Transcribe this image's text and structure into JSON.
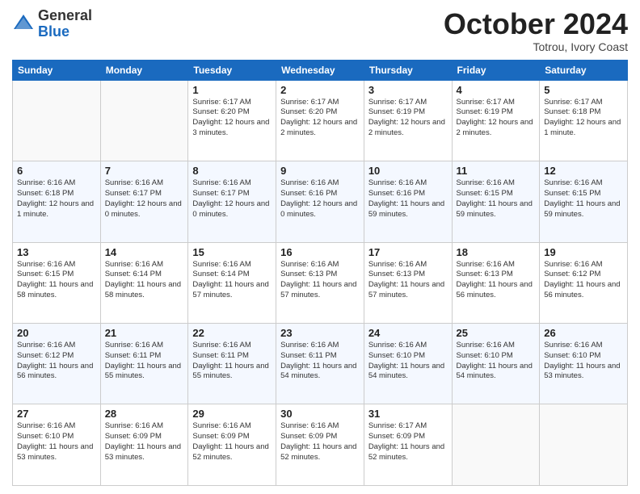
{
  "logo": {
    "general": "General",
    "blue": "Blue"
  },
  "header": {
    "month": "October 2024",
    "location": "Totrou, Ivory Coast"
  },
  "days_of_week": [
    "Sunday",
    "Monday",
    "Tuesday",
    "Wednesday",
    "Thursday",
    "Friday",
    "Saturday"
  ],
  "weeks": [
    [
      {
        "day": "",
        "info": ""
      },
      {
        "day": "",
        "info": ""
      },
      {
        "day": "1",
        "info": "Sunrise: 6:17 AM\nSunset: 6:20 PM\nDaylight: 12 hours and 3 minutes."
      },
      {
        "day": "2",
        "info": "Sunrise: 6:17 AM\nSunset: 6:20 PM\nDaylight: 12 hours and 2 minutes."
      },
      {
        "day": "3",
        "info": "Sunrise: 6:17 AM\nSunset: 6:19 PM\nDaylight: 12 hours and 2 minutes."
      },
      {
        "day": "4",
        "info": "Sunrise: 6:17 AM\nSunset: 6:19 PM\nDaylight: 12 hours and 2 minutes."
      },
      {
        "day": "5",
        "info": "Sunrise: 6:17 AM\nSunset: 6:18 PM\nDaylight: 12 hours and 1 minute."
      }
    ],
    [
      {
        "day": "6",
        "info": "Sunrise: 6:16 AM\nSunset: 6:18 PM\nDaylight: 12 hours and 1 minute."
      },
      {
        "day": "7",
        "info": "Sunrise: 6:16 AM\nSunset: 6:17 PM\nDaylight: 12 hours and 0 minutes."
      },
      {
        "day": "8",
        "info": "Sunrise: 6:16 AM\nSunset: 6:17 PM\nDaylight: 12 hours and 0 minutes."
      },
      {
        "day": "9",
        "info": "Sunrise: 6:16 AM\nSunset: 6:16 PM\nDaylight: 12 hours and 0 minutes."
      },
      {
        "day": "10",
        "info": "Sunrise: 6:16 AM\nSunset: 6:16 PM\nDaylight: 11 hours and 59 minutes."
      },
      {
        "day": "11",
        "info": "Sunrise: 6:16 AM\nSunset: 6:15 PM\nDaylight: 11 hours and 59 minutes."
      },
      {
        "day": "12",
        "info": "Sunrise: 6:16 AM\nSunset: 6:15 PM\nDaylight: 11 hours and 59 minutes."
      }
    ],
    [
      {
        "day": "13",
        "info": "Sunrise: 6:16 AM\nSunset: 6:15 PM\nDaylight: 11 hours and 58 minutes."
      },
      {
        "day": "14",
        "info": "Sunrise: 6:16 AM\nSunset: 6:14 PM\nDaylight: 11 hours and 58 minutes."
      },
      {
        "day": "15",
        "info": "Sunrise: 6:16 AM\nSunset: 6:14 PM\nDaylight: 11 hours and 57 minutes."
      },
      {
        "day": "16",
        "info": "Sunrise: 6:16 AM\nSunset: 6:13 PM\nDaylight: 11 hours and 57 minutes."
      },
      {
        "day": "17",
        "info": "Sunrise: 6:16 AM\nSunset: 6:13 PM\nDaylight: 11 hours and 57 minutes."
      },
      {
        "day": "18",
        "info": "Sunrise: 6:16 AM\nSunset: 6:13 PM\nDaylight: 11 hours and 56 minutes."
      },
      {
        "day": "19",
        "info": "Sunrise: 6:16 AM\nSunset: 6:12 PM\nDaylight: 11 hours and 56 minutes."
      }
    ],
    [
      {
        "day": "20",
        "info": "Sunrise: 6:16 AM\nSunset: 6:12 PM\nDaylight: 11 hours and 56 minutes."
      },
      {
        "day": "21",
        "info": "Sunrise: 6:16 AM\nSunset: 6:11 PM\nDaylight: 11 hours and 55 minutes."
      },
      {
        "day": "22",
        "info": "Sunrise: 6:16 AM\nSunset: 6:11 PM\nDaylight: 11 hours and 55 minutes."
      },
      {
        "day": "23",
        "info": "Sunrise: 6:16 AM\nSunset: 6:11 PM\nDaylight: 11 hours and 54 minutes."
      },
      {
        "day": "24",
        "info": "Sunrise: 6:16 AM\nSunset: 6:10 PM\nDaylight: 11 hours and 54 minutes."
      },
      {
        "day": "25",
        "info": "Sunrise: 6:16 AM\nSunset: 6:10 PM\nDaylight: 11 hours and 54 minutes."
      },
      {
        "day": "26",
        "info": "Sunrise: 6:16 AM\nSunset: 6:10 PM\nDaylight: 11 hours and 53 minutes."
      }
    ],
    [
      {
        "day": "27",
        "info": "Sunrise: 6:16 AM\nSunset: 6:10 PM\nDaylight: 11 hours and 53 minutes."
      },
      {
        "day": "28",
        "info": "Sunrise: 6:16 AM\nSunset: 6:09 PM\nDaylight: 11 hours and 53 minutes."
      },
      {
        "day": "29",
        "info": "Sunrise: 6:16 AM\nSunset: 6:09 PM\nDaylight: 11 hours and 52 minutes."
      },
      {
        "day": "30",
        "info": "Sunrise: 6:16 AM\nSunset: 6:09 PM\nDaylight: 11 hours and 52 minutes."
      },
      {
        "day": "31",
        "info": "Sunrise: 6:17 AM\nSunset: 6:09 PM\nDaylight: 11 hours and 52 minutes."
      },
      {
        "day": "",
        "info": ""
      },
      {
        "day": "",
        "info": ""
      }
    ]
  ]
}
